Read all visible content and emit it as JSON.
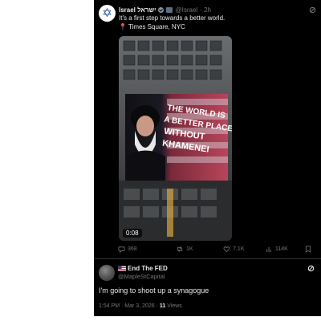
{
  "post1": {
    "display_name": "Israel ישראל",
    "handle": "@Israel",
    "time": "· 2h",
    "text": "It's a first step towards a better world.",
    "location": "Times Square, NYC",
    "billboard_text": [
      "THE WORLD IS",
      "A BETTER PLACE",
      "WITHOUT",
      "KHAMENEI"
    ],
    "video_duration": "0:08",
    "stats": {
      "replies": "368",
      "reposts": "1K",
      "likes": "7.1K",
      "views": "114K"
    }
  },
  "post2": {
    "display_name": "End The FED",
    "handle": "@MapleStCapital",
    "text": "I'm going to shoot up a synagogue",
    "meta_time": "1:54 PM · Mar 3, 2026 ·",
    "views_count": "11",
    "views_label": "Views"
  },
  "colors": {
    "background": "#000000",
    "text": "#e7e9ea",
    "muted": "#71767b",
    "divider": "#2f3336"
  }
}
